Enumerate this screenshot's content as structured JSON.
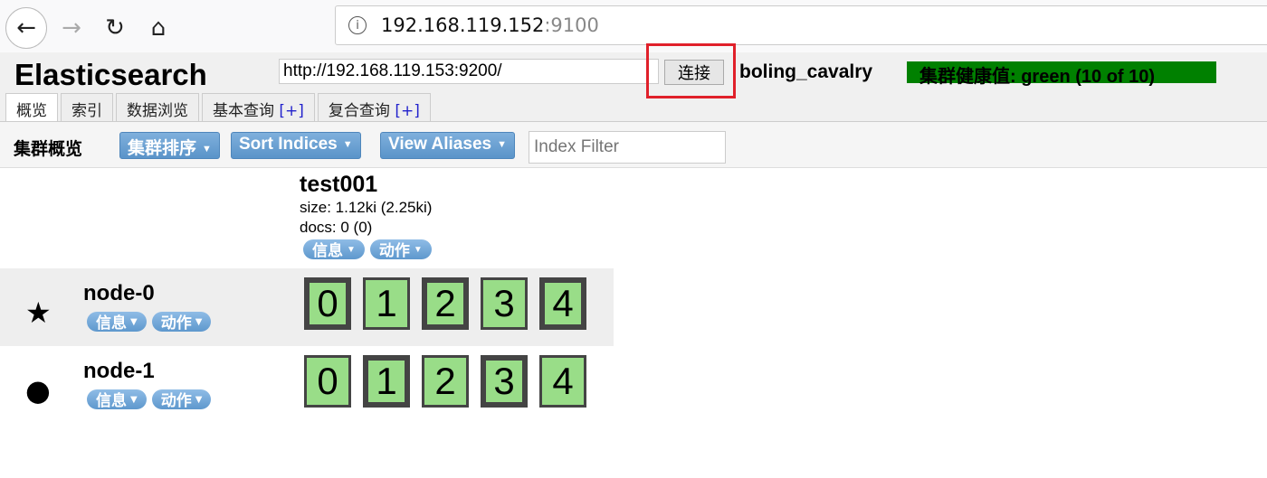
{
  "browser": {
    "url_host": "192.168.119.152",
    "url_port": ":9100",
    "icons": [
      "back-icon",
      "forward-icon",
      "reload-icon",
      "home-icon",
      "info-icon"
    ]
  },
  "app": {
    "logo": "Elasticsearch",
    "connect_url": "http://192.168.119.153:9200/",
    "connect_label": "连接",
    "cluster_name": "boling_cavalry",
    "health": "集群健康值: green (10 of 10)",
    "health_color": "#008000",
    "tabs": [
      {
        "label": "概览",
        "plus": ""
      },
      {
        "label": "索引",
        "plus": ""
      },
      {
        "label": "数据浏览",
        "plus": ""
      },
      {
        "label": "基本查询",
        "plus": "[+]"
      },
      {
        "label": "复合查询",
        "plus": "[+]"
      }
    ]
  },
  "toolbar": {
    "title": "集群概览",
    "sort_cluster": "集群排序",
    "sort_indices": "Sort Indices",
    "view_aliases": "View Aliases",
    "filter_placeholder": "Index Filter"
  },
  "index": {
    "name": "test001",
    "size": "size: 1.12ki (2.25ki)",
    "docs": "docs: 0 (0)",
    "info": "信息",
    "actions": "动作"
  },
  "nodes": [
    {
      "name": "node-0",
      "icon": "star",
      "info": "信息",
      "actions": "动作",
      "shards": [
        "0",
        "1",
        "2",
        "3",
        "4"
      ],
      "primary": [
        true,
        false,
        true,
        false,
        true
      ]
    },
    {
      "name": "node-1",
      "icon": "circle",
      "info": "信息",
      "actions": "动作",
      "shards": [
        "0",
        "1",
        "2",
        "3",
        "4"
      ],
      "primary": [
        false,
        true,
        false,
        true,
        false
      ]
    }
  ],
  "shard_color": "#99dd88"
}
